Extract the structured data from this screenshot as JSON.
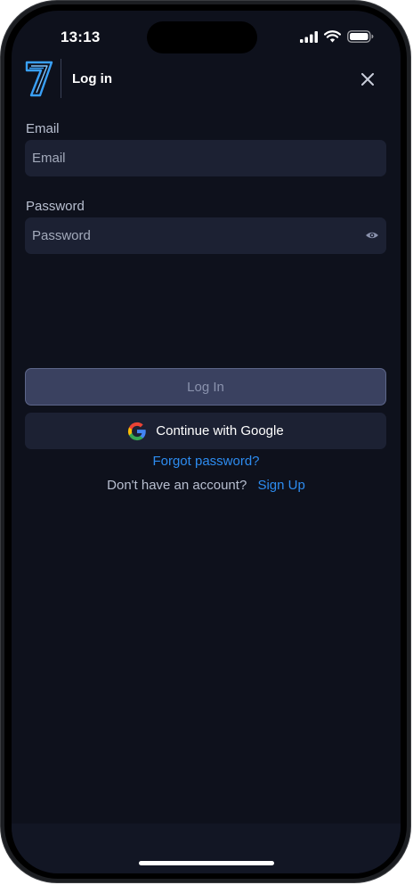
{
  "status_bar": {
    "time": "13:13",
    "icons": [
      "signal-icon",
      "wifi-icon",
      "battery-icon"
    ]
  },
  "header": {
    "logo_icon": "seven-logo-icon",
    "title": "Log in",
    "close_icon": "close-icon"
  },
  "form": {
    "email": {
      "label": "Email",
      "placeholder": "Email",
      "value": ""
    },
    "password": {
      "label": "Password",
      "placeholder": "Password",
      "value": "",
      "toggle_icon": "eye-icon"
    },
    "login_button": "Log In",
    "google_button": "Continue with Google",
    "forgot_password": "Forgot password?",
    "signup_prompt": "Don't have an account?",
    "signup_link": "Sign Up"
  },
  "colors": {
    "background": "#0e111c",
    "input_background": "#1c2133",
    "login_button_background": "#3a4160",
    "link": "#2d8cf0",
    "logo_accent": "#39a0f7"
  }
}
